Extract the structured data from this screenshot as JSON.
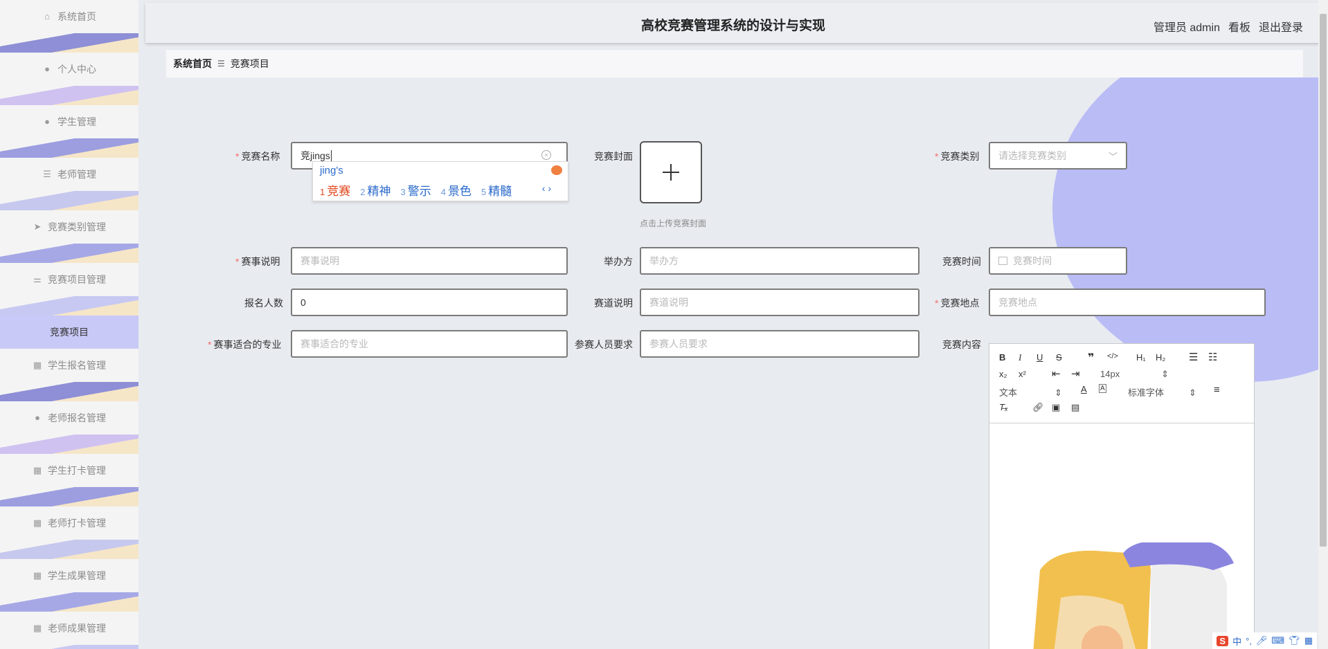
{
  "sidebar": {
    "items": [
      {
        "label": "系统首页",
        "icon": "home-icon"
      },
      {
        "label": "个人中心",
        "icon": "user-icon"
      },
      {
        "label": "学生管理",
        "icon": "user-icon"
      },
      {
        "label": "老师管理",
        "icon": "list-icon"
      },
      {
        "label": "竞赛类别管理",
        "icon": "send-icon"
      },
      {
        "label": "竞赛项目管理",
        "icon": "sliders-icon"
      }
    ],
    "active_sub": "竞赛项目",
    "items_after": [
      {
        "label": "学生报名管理",
        "icon": "grid-icon"
      },
      {
        "label": "老师报名管理",
        "icon": "user-icon"
      },
      {
        "label": "学生打卡管理",
        "icon": "grid-icon"
      },
      {
        "label": "老师打卡管理",
        "icon": "grid-icon"
      },
      {
        "label": "学生成果管理",
        "icon": "grid-icon"
      },
      {
        "label": "老师成果管理",
        "icon": "grid-icon"
      }
    ]
  },
  "header": {
    "title": "高校竞赛管理系统的设计与实现",
    "user": "管理员 admin",
    "board": "看板",
    "logout": "退出登录"
  },
  "breadcrumb": {
    "home": "系统首页",
    "separator": "☰",
    "current": "竞赛项目"
  },
  "form": {
    "name": {
      "label": "竞赛名称",
      "value": "竞jings"
    },
    "cover": {
      "label": "竞赛封面",
      "tip": "点击上传竞赛封面"
    },
    "category": {
      "label": "竞赛类别",
      "placeholder": "请选择竞赛类别"
    },
    "desc": {
      "label": "赛事说明",
      "placeholder": "赛事说明"
    },
    "organizer": {
      "label": "举办方",
      "placeholder": "举办方"
    },
    "time": {
      "label": "竞赛时间",
      "placeholder": "竞赛时间"
    },
    "count": {
      "label": "报名人数",
      "value": "0"
    },
    "track": {
      "label": "赛道说明",
      "placeholder": "赛道说明"
    },
    "location": {
      "label": "竞赛地点",
      "placeholder": "竞赛地点"
    },
    "major": {
      "label": "赛事适合的专业",
      "placeholder": "赛事适合的专业"
    },
    "requirement": {
      "label": "参赛人员要求",
      "placeholder": "参赛人员要求"
    },
    "content": {
      "label": "竞赛内容"
    }
  },
  "ime": {
    "typed": "jing's",
    "candidates": [
      {
        "n": "1",
        "text": "竞赛"
      },
      {
        "n": "2",
        "text": "精神"
      },
      {
        "n": "3",
        "text": "警示"
      },
      {
        "n": "4",
        "text": "景色"
      },
      {
        "n": "5",
        "text": "精髓"
      }
    ]
  },
  "editor": {
    "font_size": "14px",
    "paragraph": "文本",
    "font_family": "标准字体"
  },
  "tray": {
    "lang": "中"
  },
  "colors": {
    "accent": "#c9c9f7",
    "required": "#f56c6c",
    "ime_blue": "#2a6acb",
    "ime_first": "#e0461c"
  }
}
